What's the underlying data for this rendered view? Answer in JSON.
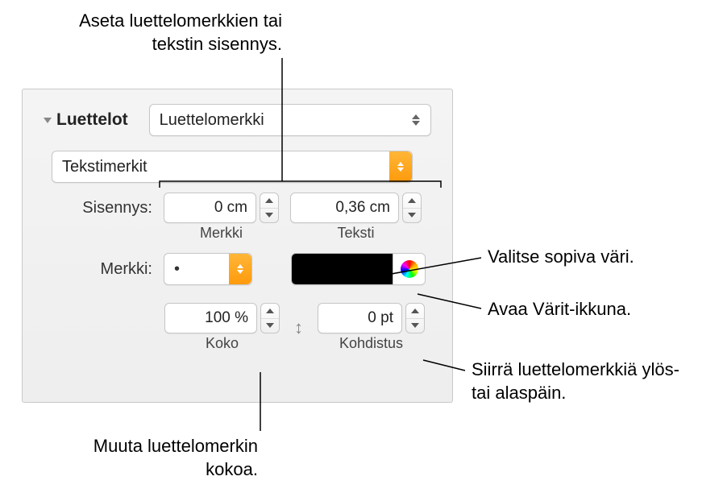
{
  "callouts": {
    "top": "Aseta luettelomerkkien tai tekstin sisennys.",
    "color1": "Valitse sopiva väri.",
    "color2": "Avaa Värit-ikkuna.",
    "align": "Siirrä luettelomerkkiä ylös- tai alaspäin.",
    "size": "Muuta luettelomerkin kokoa."
  },
  "panel": {
    "section_title": "Luettelot",
    "list_type_popup": "Luettelomerkki",
    "bullet_type_popup": "Tekstimerkit",
    "indent_label": "Sisennys:",
    "indent_bullet_value": "0 cm",
    "indent_bullet_sublabel": "Merkki",
    "indent_text_value": "0,36 cm",
    "indent_text_sublabel": "Teksti",
    "char_label": "Merkki:",
    "char_value": "•",
    "size_value": "100 %",
    "size_sublabel": "Koko",
    "align_value": "0 pt",
    "align_sublabel": "Kohdistus"
  }
}
